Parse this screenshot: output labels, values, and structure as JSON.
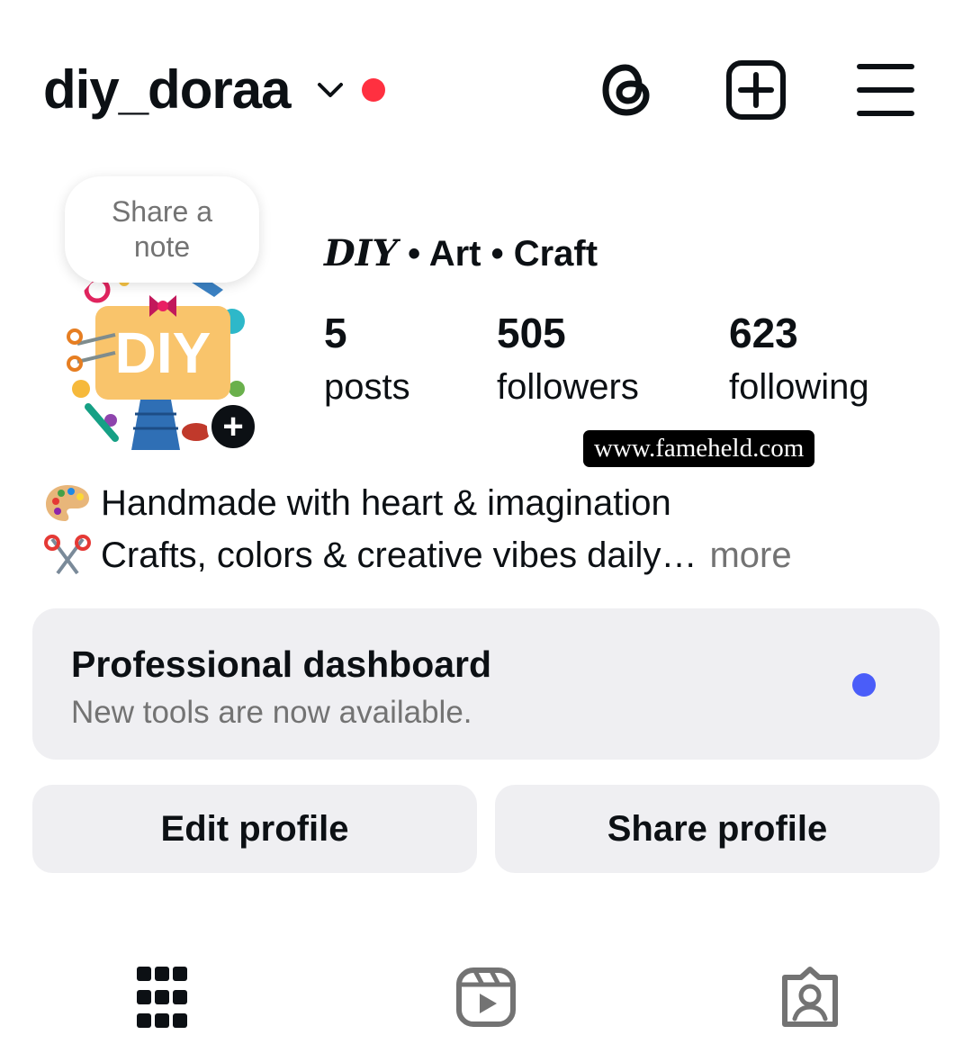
{
  "header": {
    "username": "diy_doraa",
    "icons": [
      "chevron-down-icon",
      "notification-dot",
      "threads-icon",
      "add-post-icon",
      "menu-icon"
    ]
  },
  "note": {
    "text": "Share a note"
  },
  "profile": {
    "display_name_prefix": "DIY",
    "display_name_rest": " • Art • Craft",
    "stats": [
      {
        "value": "5",
        "label": "posts"
      },
      {
        "value": "505",
        "label": "followers"
      },
      {
        "value": "623",
        "label": "following"
      }
    ]
  },
  "watermark": "www.fameheld.com",
  "bio": {
    "line1": "Handmade with heart & imagination",
    "line2": "Crafts, colors & creative vibes daily",
    "ellipsis": "…",
    "more": "more"
  },
  "dashboard": {
    "title": "Professional dashboard",
    "subtitle": "New tools are now available."
  },
  "buttons": {
    "edit": "Edit profile",
    "share": "Share profile"
  },
  "tabs": [
    "grid-icon",
    "reels-icon",
    "tagged-icon"
  ],
  "colors": {
    "notification_red": "#ff3040",
    "accent_blue": "#4a5df9",
    "card_bg": "#efeff2",
    "muted_text": "#737373"
  }
}
